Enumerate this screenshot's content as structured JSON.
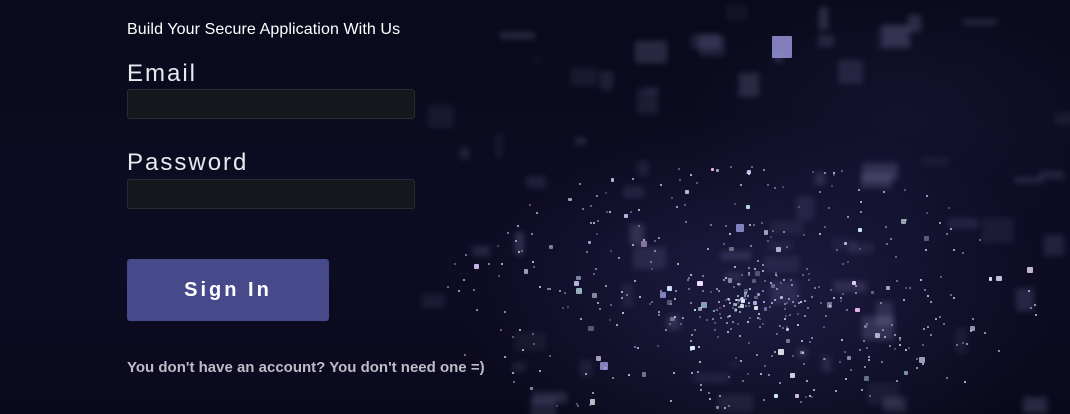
{
  "page": {
    "headline": "Build Your Secure Application With Us",
    "background_icon": "digital-city-particles-background"
  },
  "form": {
    "email_label": "Email",
    "email_value": "",
    "password_label": "Password",
    "password_value": "",
    "submit_label": "Sign In",
    "footer_note": "You don't have an account? You don't need one =)"
  },
  "colors": {
    "background": "#0b0a1e",
    "button": "#46498a",
    "field": "#16161d",
    "text": "#ffffff"
  }
}
